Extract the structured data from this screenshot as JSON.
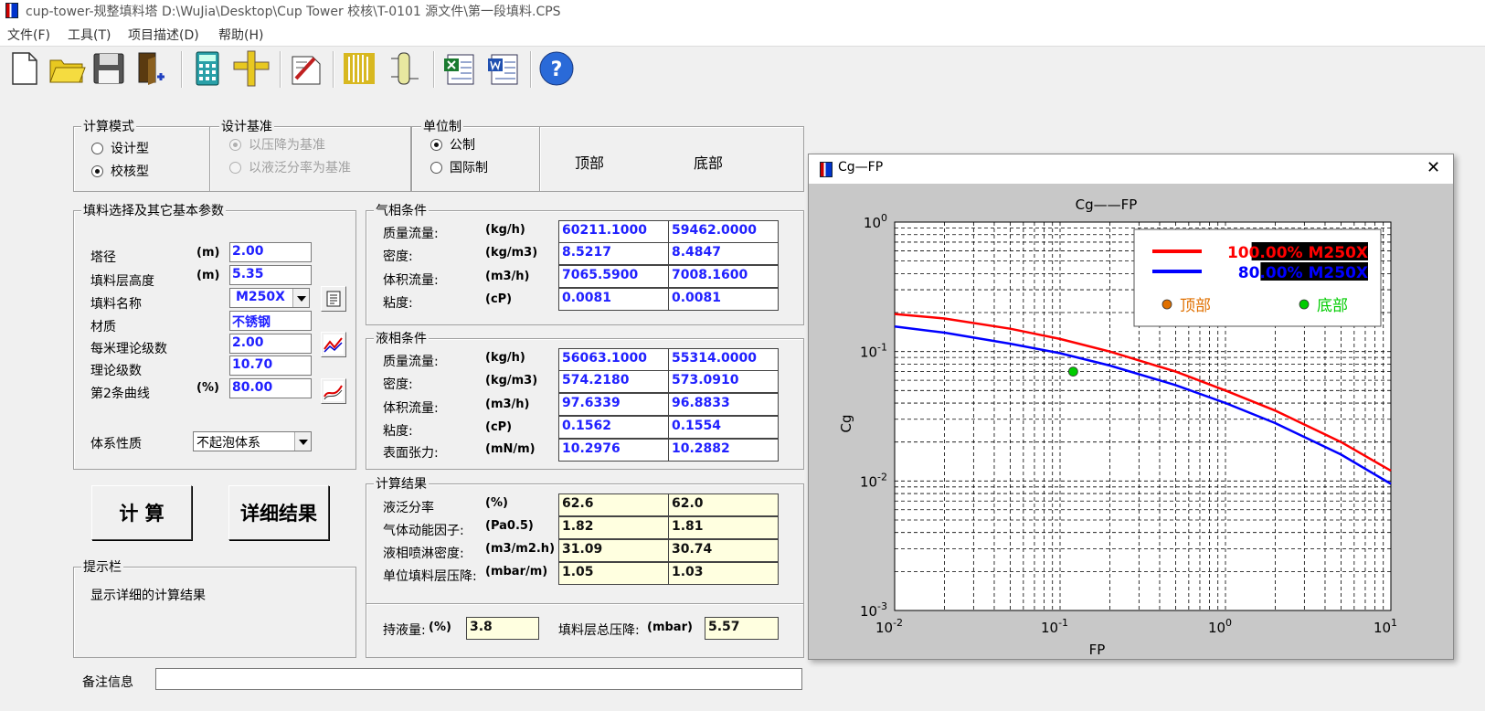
{
  "window": {
    "title": "cup-tower-规整填料塔    D:\\WuJia\\Desktop\\Cup Tower 校核\\T-0101 源文件\\第一段填料.CPS"
  },
  "menu": [
    "文件(F)",
    "工具(T)",
    "项目描述(D)",
    "帮助(H)"
  ],
  "toolbar_icons": [
    "new-file-icon",
    "open-folder-icon",
    "save-disk-icon",
    "exit-door-icon",
    "calculator-icon",
    "ruler-icon",
    "report-icon",
    "tower-packing-icon",
    "column-diagram-icon",
    "excel-export-icon",
    "word-export-icon",
    "help-icon"
  ],
  "calc_mode": {
    "title": "计算模式",
    "options": [
      "设计型",
      "校核型"
    ],
    "selected": "校核型"
  },
  "design_basis": {
    "title": "设计基准",
    "options": [
      "以压降为基准",
      "以液泛分率为基准"
    ],
    "selected": "以压降为基准",
    "enabled": false
  },
  "unit_system": {
    "title": "单位制",
    "options": [
      "公制",
      "国际制"
    ],
    "selected": "公制"
  },
  "columns": {
    "top": "顶部",
    "bottom": "底部"
  },
  "packing": {
    "title": "填料选择及其它基本参数",
    "rows": [
      {
        "label": "塔径",
        "unit": "(m)",
        "value": "2.00"
      },
      {
        "label": "填料层高度",
        "unit": "(m)",
        "value": "5.35"
      },
      {
        "label": "填料名称",
        "unit": "",
        "value": "M250X"
      },
      {
        "label": "材质",
        "unit": "",
        "value": "不锈钢"
      },
      {
        "label": "每米理论级数",
        "unit": "",
        "value": "2.00"
      },
      {
        "label": "理论级数",
        "unit": "",
        "value": "10.70"
      },
      {
        "label": "第2条曲线",
        "unit": "(%)",
        "value": "80.00"
      }
    ],
    "system_label": "体系性质",
    "system_value": "不起泡体系"
  },
  "gas": {
    "title": "气相条件",
    "rows": [
      {
        "label": "质量流量:",
        "unit": "(kg/h)",
        "top": "60211.1000",
        "bottom": "59462.0000"
      },
      {
        "label": "密度:",
        "unit": "(kg/m3)",
        "top": "8.5217",
        "bottom": "8.4847"
      },
      {
        "label": "体积流量:",
        "unit": "(m3/h)",
        "top": "7065.5900",
        "bottom": "7008.1600"
      },
      {
        "label": "粘度:",
        "unit": "(cP)",
        "top": "0.0081",
        "bottom": "0.0081"
      }
    ]
  },
  "liquid": {
    "title": "液相条件",
    "rows": [
      {
        "label": "质量流量:",
        "unit": "(kg/h)",
        "top": "56063.1000",
        "bottom": "55314.0000"
      },
      {
        "label": "密度:",
        "unit": "(kg/m3)",
        "top": "574.2180",
        "bottom": "573.0910"
      },
      {
        "label": "体积流量:",
        "unit": "(m3/h)",
        "top": "97.6339",
        "bottom": "96.8833"
      },
      {
        "label": "粘度:",
        "unit": "(cP)",
        "top": "0.1562",
        "bottom": "0.1554"
      },
      {
        "label": "表面张力:",
        "unit": "(mN/m)",
        "top": "10.2976",
        "bottom": "10.2882"
      }
    ]
  },
  "results": {
    "title": "计算结果",
    "rows": [
      {
        "label": "液泛分率",
        "unit": "(%)",
        "top": "62.6",
        "bottom": "62.0"
      },
      {
        "label": "气体动能因子:",
        "unit": "(Pa0.5)",
        "top": "1.82",
        "bottom": "1.81"
      },
      {
        "label": "液相喷淋密度:",
        "unit": "(m3/m2.h)",
        "top": "31.09",
        "bottom": "30.74"
      },
      {
        "label": "单位填料层压降:",
        "unit": "(mbar/m)",
        "top": "1.05",
        "bottom": "1.03"
      }
    ],
    "holdup_label": "持液量:",
    "holdup_unit": "(%)",
    "holdup_value": "3.8",
    "total_dp_label": "填料层总压降:",
    "total_dp_unit": "(mbar)",
    "total_dp_value": "5.57"
  },
  "buttons": {
    "calc": "计 算",
    "details": "详细结果"
  },
  "hint": {
    "title": "提示栏",
    "text": "显示详细的计算结果"
  },
  "notes": {
    "label": "备注信息",
    "value": ""
  },
  "chart_window": {
    "title": "Cg—FP",
    "close": "✕"
  },
  "chart_data": {
    "type": "line",
    "title": "Cg——FP",
    "xlabel": "FP",
    "ylabel": "Cg",
    "x_scale": "log",
    "y_scale": "log",
    "xlim": [
      0.01,
      10
    ],
    "ylim": [
      0.001,
      1
    ],
    "x_ticks": [
      "10-2",
      "10-1",
      "100",
      "101"
    ],
    "y_ticks": [
      "10-3",
      "10-2",
      "10-1",
      "100"
    ],
    "grid": true,
    "legend_position": "top-right",
    "series": [
      {
        "name": "100.00% M250X",
        "color": "#ff0000",
        "x": [
          0.01,
          0.02,
          0.05,
          0.1,
          0.2,
          0.5,
          1,
          2,
          5,
          10
        ],
        "y": [
          0.195,
          0.18,
          0.15,
          0.125,
          0.1,
          0.07,
          0.05,
          0.035,
          0.02,
          0.012
        ]
      },
      {
        "name": "80.00% M250X",
        "color": "#0000ff",
        "x": [
          0.01,
          0.02,
          0.05,
          0.1,
          0.2,
          0.5,
          1,
          2,
          5,
          10
        ],
        "y": [
          0.156,
          0.14,
          0.115,
          0.097,
          0.078,
          0.055,
          0.04,
          0.028,
          0.016,
          0.0095
        ]
      }
    ],
    "points": [
      {
        "name": "顶部",
        "color": "#e07000",
        "x": null,
        "y": null
      },
      {
        "name": "底部",
        "color": "#00cc00",
        "x": 0.12,
        "y": 0.07
      }
    ]
  }
}
